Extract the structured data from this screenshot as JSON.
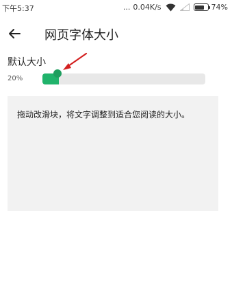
{
  "status_bar": {
    "time": "下午5:37",
    "dots": "...",
    "net_speed": "0.04K/s",
    "battery_level": "74%"
  },
  "header": {
    "back_icon": "arrow-left-icon",
    "title": "网页字体大小"
  },
  "font_setting": {
    "label": "默认大小",
    "value_percent": "20%",
    "slider_level": 0.1,
    "accent_color": "#20b36b",
    "annotation_arrow_color": "#d32020"
  },
  "preview": {
    "text": "拖动改滑块，将文字调整到适合您阅读的大小。"
  }
}
